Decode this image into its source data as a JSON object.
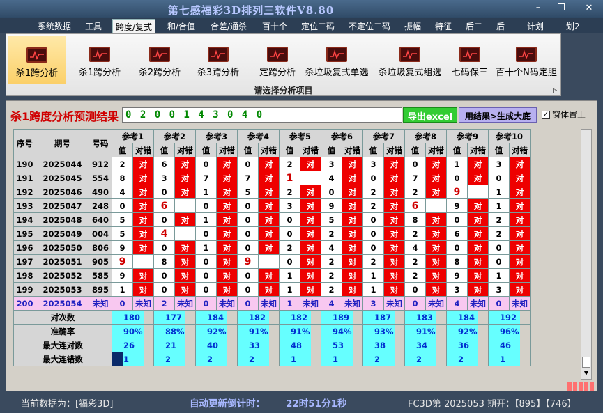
{
  "window": {
    "title": "第七感福彩3D排列三软件V8.80"
  },
  "menu": [
    "系统数据",
    "工具",
    "跨度/复式",
    "和/合值",
    "合差/通杀",
    "百十个",
    "定位二码",
    "不定位二码",
    "振幅",
    "特征",
    "后二",
    "后一",
    "计划",
    "划2"
  ],
  "menu_active_index": 2,
  "ribbon": {
    "buttons": [
      "杀1跨分析",
      "杀1跨分析",
      "杀2跨分析",
      "杀3跨分析",
      "定跨分析",
      "杀垃圾复式单选",
      "杀垃圾复式组选",
      "七码保三",
      "百十个N码定胆"
    ],
    "selected_index": 0,
    "icon": "chart-icon",
    "caption": "请选择分析项目"
  },
  "result": {
    "label": "杀1跨度分析预测结果",
    "value": "0 2 0 0 1 4 3 0 4 0",
    "export_button": "导出excel",
    "generate_button": "用结果>生成大底",
    "ontop_label": "窗体置上",
    "ontop_checked": true
  },
  "table": {
    "headers": {
      "seq": "序号",
      "issue": "期号",
      "number": "号码",
      "value": "值",
      "flag": "对错"
    },
    "refs": [
      "参考1",
      "参考2",
      "参考3",
      "参考4",
      "参考5",
      "参考6",
      "参考7",
      "参考8",
      "参考9",
      "参考10"
    ],
    "right": "对",
    "unknown": "未知",
    "rows": [
      {
        "seq": "190",
        "issue": "2025044",
        "number": "912",
        "values": [
          "2",
          "6",
          "0",
          "0",
          "2",
          "3",
          "3",
          "0",
          "1",
          "3"
        ],
        "hits": [
          1,
          1,
          1,
          1,
          1,
          1,
          1,
          1,
          1,
          1
        ]
      },
      {
        "seq": "191",
        "issue": "2025045",
        "number": "554",
        "values": [
          "8",
          "3",
          "7",
          "7",
          "1",
          "4",
          "0",
          "7",
          "0",
          "0"
        ],
        "hits": [
          1,
          1,
          1,
          1,
          0,
          1,
          1,
          1,
          1,
          1
        ]
      },
      {
        "seq": "192",
        "issue": "2025046",
        "number": "490",
        "values": [
          "4",
          "0",
          "1",
          "5",
          "2",
          "0",
          "2",
          "2",
          "9",
          "1"
        ],
        "hits": [
          1,
          1,
          1,
          1,
          1,
          1,
          1,
          1,
          0,
          1
        ]
      },
      {
        "seq": "193",
        "issue": "2025047",
        "number": "248",
        "values": [
          "0",
          "6",
          "0",
          "0",
          "3",
          "9",
          "2",
          "6",
          "9",
          "1"
        ],
        "hits": [
          1,
          0,
          1,
          1,
          1,
          1,
          1,
          0,
          1,
          1
        ]
      },
      {
        "seq": "194",
        "issue": "2025048",
        "number": "640",
        "values": [
          "5",
          "0",
          "1",
          "0",
          "0",
          "5",
          "0",
          "8",
          "0",
          "2"
        ],
        "hits": [
          1,
          1,
          1,
          1,
          1,
          1,
          1,
          1,
          1,
          1
        ]
      },
      {
        "seq": "195",
        "issue": "2025049",
        "number": "004",
        "values": [
          "5",
          "4",
          "0",
          "0",
          "0",
          "2",
          "0",
          "2",
          "6",
          "2"
        ],
        "hits": [
          1,
          0,
          1,
          1,
          1,
          1,
          1,
          1,
          1,
          1
        ]
      },
      {
        "seq": "196",
        "issue": "2025050",
        "number": "806",
        "values": [
          "9",
          "0",
          "1",
          "0",
          "2",
          "4",
          "0",
          "4",
          "0",
          "0"
        ],
        "hits": [
          1,
          1,
          1,
          1,
          1,
          1,
          1,
          1,
          1,
          1
        ]
      },
      {
        "seq": "197",
        "issue": "2025051",
        "number": "905",
        "values": [
          "9",
          "8",
          "0",
          "9",
          "0",
          "2",
          "2",
          "2",
          "8",
          "0"
        ],
        "hits": [
          0,
          1,
          1,
          0,
          1,
          1,
          1,
          1,
          1,
          1
        ]
      },
      {
        "seq": "198",
        "issue": "2025052",
        "number": "585",
        "values": [
          "9",
          "0",
          "0",
          "0",
          "1",
          "2",
          "1",
          "2",
          "9",
          "1"
        ],
        "hits": [
          1,
          1,
          1,
          1,
          1,
          1,
          1,
          1,
          1,
          1
        ]
      },
      {
        "seq": "199",
        "issue": "2025053",
        "number": "895",
        "values": [
          "1",
          "0",
          "0",
          "0",
          "1",
          "2",
          "1",
          "0",
          "3",
          "3"
        ],
        "hits": [
          1,
          1,
          1,
          1,
          1,
          1,
          1,
          1,
          1,
          1
        ]
      }
    ],
    "pending": {
      "seq": "200",
      "issue": "2025054",
      "number": "未知",
      "values": [
        "0",
        "2",
        "0",
        "0",
        "1",
        "4",
        "3",
        "0",
        "4",
        "0"
      ]
    },
    "stats": [
      {
        "label": "对次数",
        "values": [
          "180",
          "177",
          "184",
          "182",
          "182",
          "189",
          "187",
          "183",
          "184",
          "192"
        ]
      },
      {
        "label": "准确率",
        "values": [
          "90%",
          "88%",
          "92%",
          "91%",
          "91%",
          "94%",
          "93%",
          "91%",
          "92%",
          "96%"
        ]
      },
      {
        "label": "最大连对数",
        "values": [
          "26",
          "21",
          "40",
          "33",
          "48",
          "53",
          "38",
          "34",
          "36",
          "46"
        ]
      },
      {
        "label": "最大连错数",
        "values": [
          "1",
          "2",
          "2",
          "2",
          "1",
          "1",
          "2",
          "2",
          "2",
          "1"
        ]
      }
    ]
  },
  "status": {
    "data_source": "当前数据为：[福彩3D]",
    "timer_label": "自动更新倒计时：",
    "timer_value": "22时51分1秒",
    "issue_info": "FC3D第 2025053 期开：【895】【746】"
  }
}
